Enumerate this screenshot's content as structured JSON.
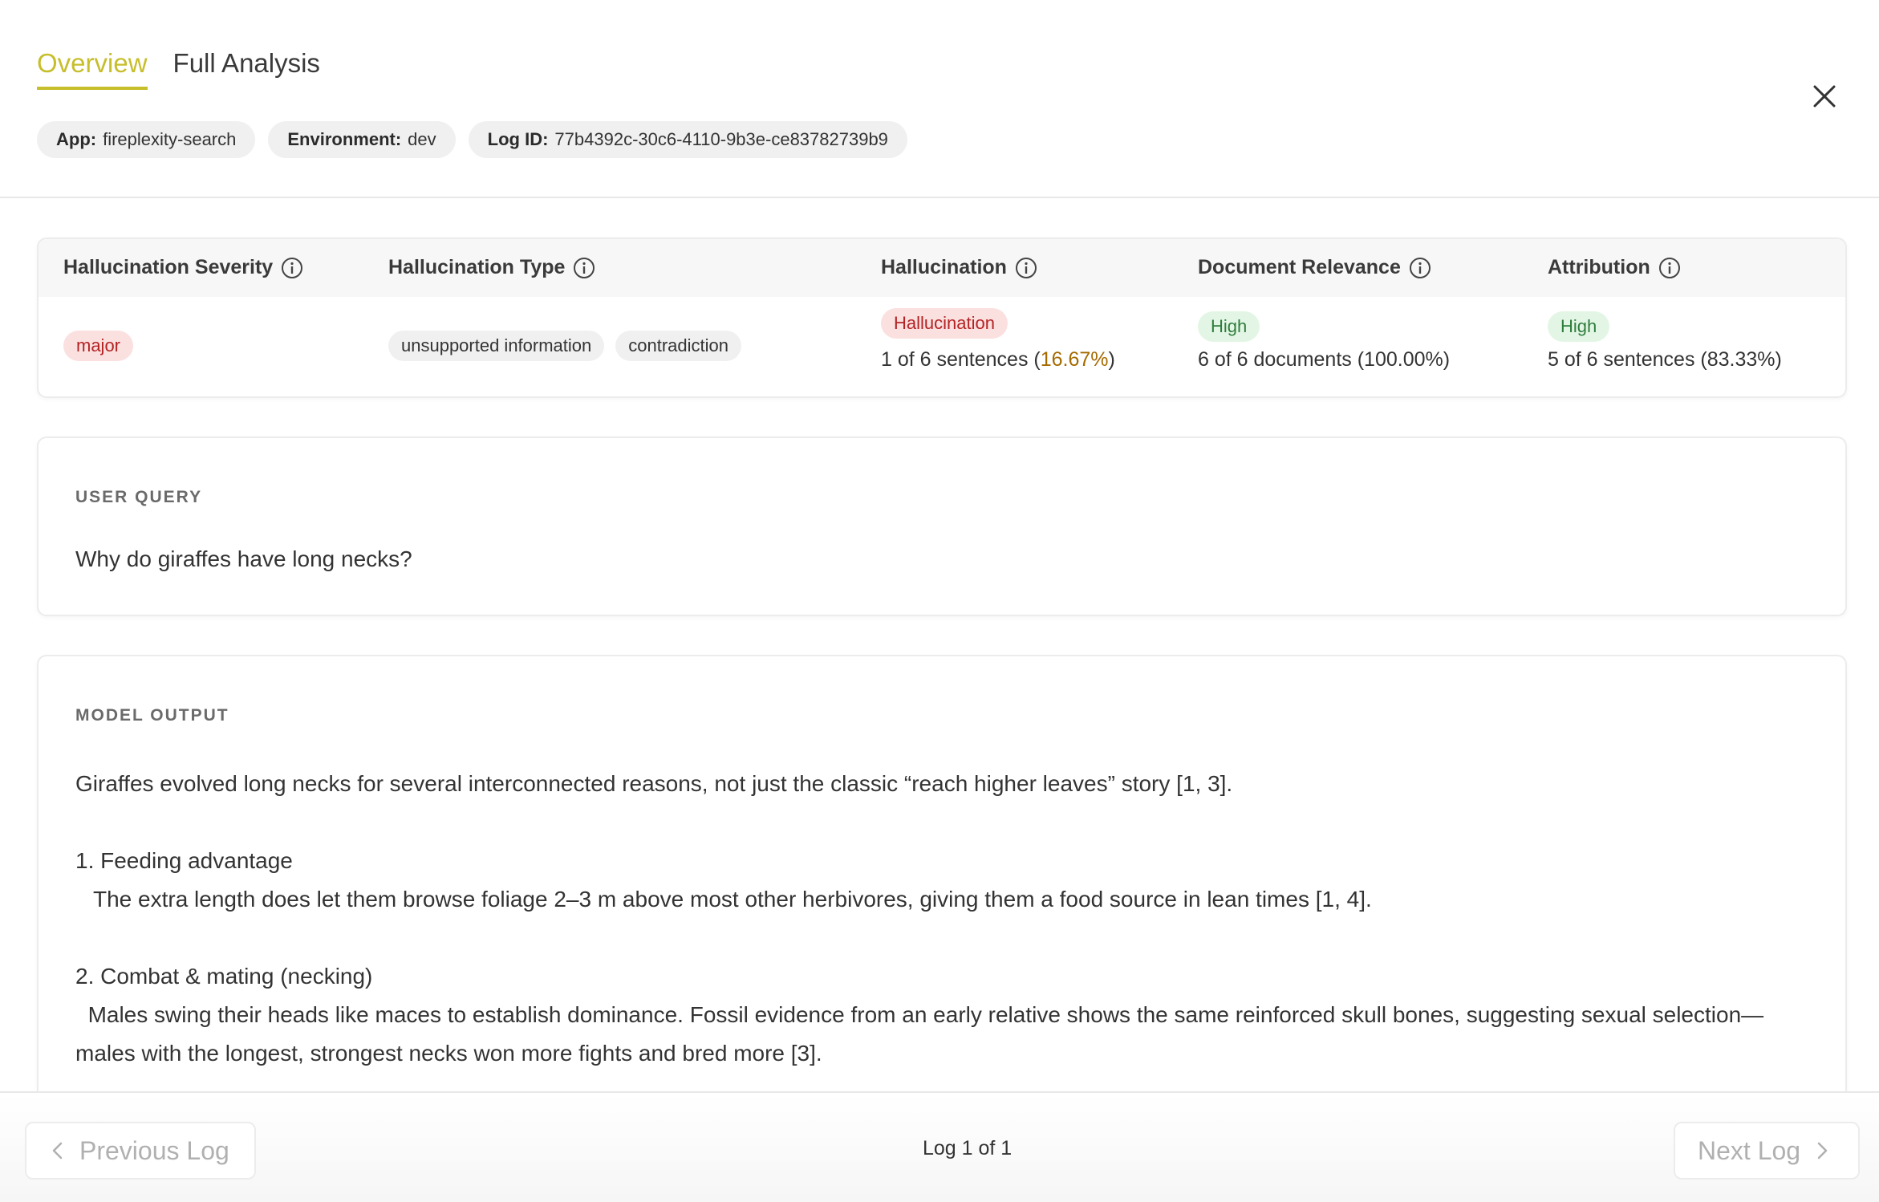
{
  "header": {
    "tabs": [
      {
        "label": "Overview",
        "active": true
      },
      {
        "label": "Full Analysis",
        "active": false
      }
    ],
    "chips": [
      {
        "key": "App:",
        "value": "fireplexity-search"
      },
      {
        "key": "Environment:",
        "value": "dev"
      },
      {
        "key": "Log ID:",
        "value": "77b4392c-30c6-4110-9b3e-ce83782739b9"
      }
    ],
    "close_icon": "close-icon"
  },
  "metrics": {
    "columns": [
      {
        "title": "Hallucination Severity",
        "icon": "info-icon"
      },
      {
        "title": "Hallucination Type",
        "icon": "info-icon"
      },
      {
        "title": "Hallucination",
        "icon": "info-icon"
      },
      {
        "title": "Document Relevance",
        "icon": "info-icon"
      },
      {
        "title": "Attribution",
        "icon": "info-icon"
      }
    ],
    "severity": "major",
    "types": [
      "unsupported information",
      "contradiction"
    ],
    "hallucination": {
      "badge": "Hallucination",
      "stat_prefix": "1 of 6 sentences (",
      "stat_percent": "16.67%",
      "stat_suffix": ")"
    },
    "relevance": {
      "badge": "High",
      "stat": "6 of 6 documents (100.00%)"
    },
    "attribution": {
      "badge": "High",
      "stat": "5 of 6 sentences (83.33%)"
    }
  },
  "query": {
    "label": "USER QUERY",
    "text": "Why do giraffes have long necks?"
  },
  "output": {
    "label": "MODEL OUTPUT",
    "intro": "Giraffes evolved long necks for several interconnected reasons, not just the classic “reach higher leaves” story [1, 3].",
    "items": [
      {
        "heading": "1. Feeding advantage",
        "body": "The extra length does let them browse foliage 2–3 m above most other herbivores, giving them a food source in lean times [1, 4]."
      },
      {
        "heading": "2. Combat & mating (necking)",
        "body": "Males swing their heads like maces to establish dominance. Fossil evidence from an early relative shows the same reinforced skull bones, suggesting sexual selection—males with the longest, strongest necks won more fights and bred more [3]."
      }
    ]
  },
  "footer": {
    "prev_label": "Previous Log",
    "next_label": "Next Log",
    "page_count": "Log 1 of 1"
  },
  "colors": {
    "accent": "#c7be2c",
    "danger_bg": "#fbe0e0",
    "danger_text": "#b42323",
    "success_bg": "#e3f6e5",
    "success_text": "#2f7d3c",
    "warn_text": "#a56a00"
  }
}
